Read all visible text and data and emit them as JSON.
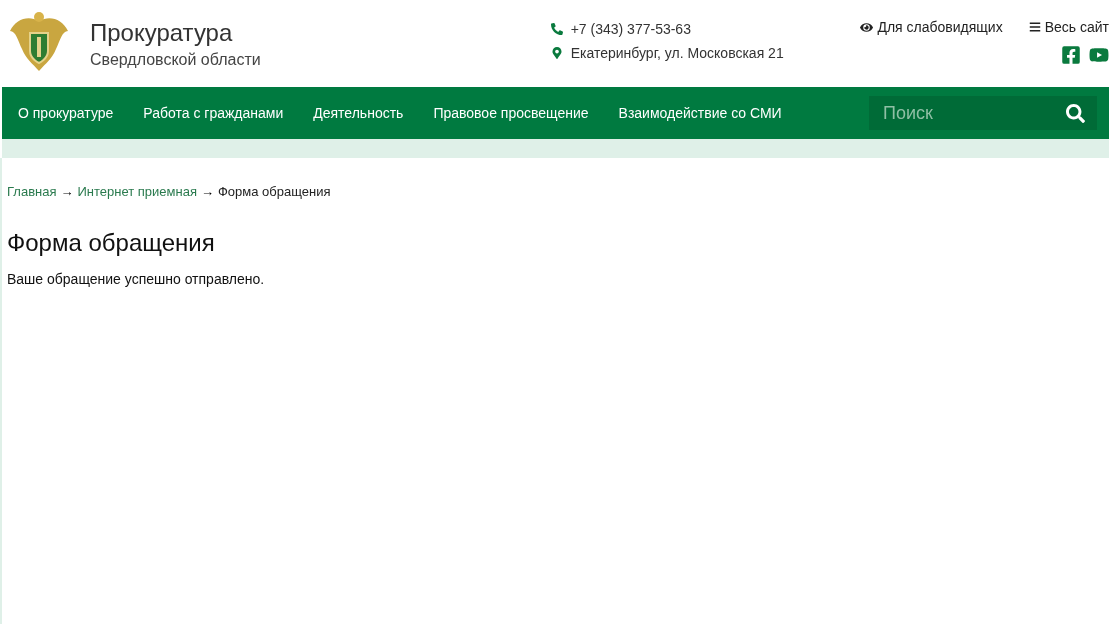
{
  "header": {
    "title": "Прокуратура",
    "subtitle": "Свердловской области",
    "phone": "+7 (343) 377-53-63",
    "address": "Екатеринбург, ул. Московская 21",
    "accessibility_link": "Для слабовидящих",
    "sitemap_link": "Весь сайт"
  },
  "nav": {
    "items": [
      {
        "label": "О прокуратуре"
      },
      {
        "label": "Работа с гражданами"
      },
      {
        "label": "Деятельность"
      },
      {
        "label": "Правовое просвещение"
      },
      {
        "label": "Взаимодействие со СМИ"
      }
    ],
    "search": {
      "placeholder": "Поиск"
    }
  },
  "breadcrumbs": [
    {
      "kind": "link",
      "text": "Главная"
    },
    {
      "kind": "separator",
      "text": "→"
    },
    {
      "kind": "link",
      "text": "Интернет приемная"
    },
    {
      "kind": "separator",
      "text": "→"
    },
    {
      "kind": "current",
      "text": "Форма обращения"
    }
  ],
  "page": {
    "title": "Форма обращения",
    "message": "Ваше обращение успешно отправлено."
  }
}
